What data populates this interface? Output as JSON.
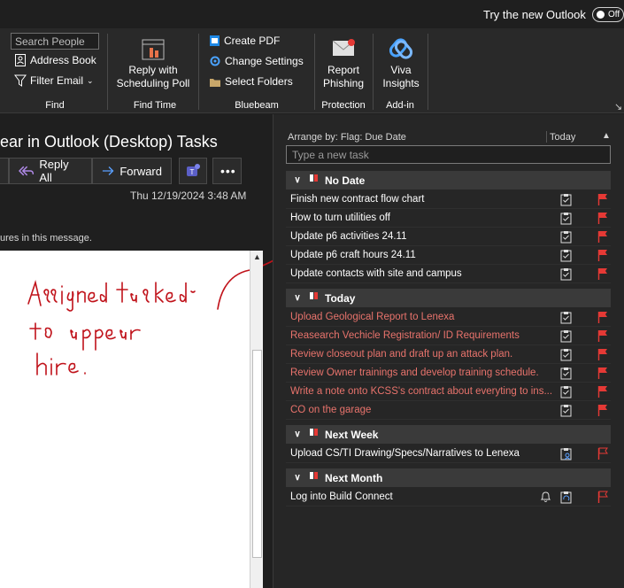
{
  "topbar": {
    "try_label": "Try the new Outlook",
    "toggle_label": "Off"
  },
  "ribbon": {
    "find": {
      "search_placeholder": "Search People",
      "address_book": "Address Book",
      "filter_email": "Filter Email",
      "group_label": "Find"
    },
    "find_time": {
      "reply_poll": "Reply with",
      "reply_poll_2": "Scheduling Poll",
      "group_label": "Find Time"
    },
    "bluebeam": {
      "create_pdf": "Create PDF",
      "change_settings": "Change Settings",
      "select_folders": "Select Folders",
      "group_label": "Bluebeam"
    },
    "protection": {
      "report": "Report",
      "report_2": "Phishing",
      "group_label": "Protection"
    },
    "addin": {
      "viva": "Viva",
      "viva_2": "Insights",
      "group_label": "Add-in"
    }
  },
  "message": {
    "subject": "ear in Outlook (Desktop) Tasks",
    "reply_all": "Reply All",
    "forward": "Forward",
    "date": "Thu 12/19/2024 3:48 AM",
    "notice": "ures in this message."
  },
  "tasks": {
    "arrange_by": "Arrange by: Flag: Due Date",
    "today_col": "Today",
    "new_task_placeholder": "Type a new task",
    "groups": [
      {
        "title": "No Date",
        "items": [
          "Finish new contract flow chart",
          "How to turn utilities off",
          "Update p6 activities 24.11",
          "Update p6 craft hours 24.11",
          "Update contacts with site and campus"
        ]
      },
      {
        "title": "Today",
        "items": [
          "Upload Geological Report to Lenexa",
          "Reasearch Vechicle Registration/ ID Requirements",
          "Review closeout plan and draft up an attack plan.",
          "Review Owner trainings and develop training schedule.",
          "Write a note onto KCSS's contract about everyting to ins...",
          "CO on the garage"
        ]
      },
      {
        "title": "Next Week",
        "items": [
          "Upload CS/TI Drawing/Specs/Narratives to Lenexa"
        ]
      },
      {
        "title": "Next Month",
        "items": [
          "Log into Build Connect"
        ]
      }
    ]
  },
  "colors": {
    "accent": "#e8736c",
    "flag": "#e53935",
    "background": "#1f1f1f"
  }
}
